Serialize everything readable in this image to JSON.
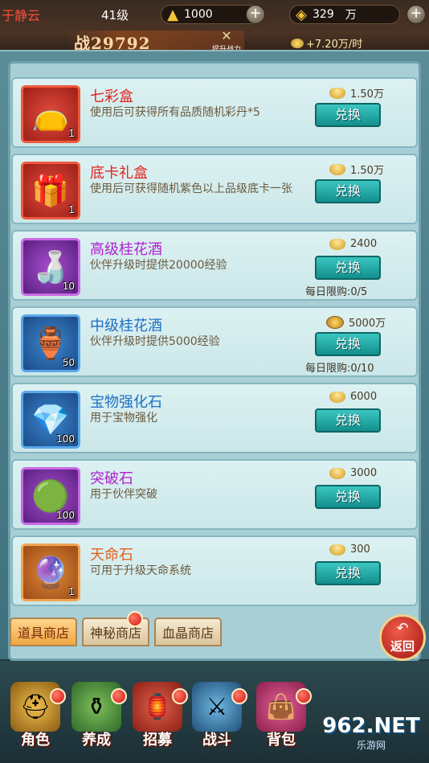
{
  "hud": {
    "player_name": "于静云",
    "level": "41级",
    "gold_ingot": "1000",
    "copper": "329",
    "copper_unit": "万",
    "power_label": "战",
    "power": "29792",
    "boost_label": "提升战力",
    "income": "+7.20万/时"
  },
  "items": [
    {
      "name": "七彩盒",
      "desc": "使用后可获得所有品质随机彩丹*5",
      "price": "1.50万",
      "price_type": "ingot",
      "count": "1",
      "button": "兑换",
      "limit": "",
      "icon": "pouch-icon"
    },
    {
      "name": "底卡礼盒",
      "desc": "使用后可获得随机紫色以上品级底卡一张",
      "price": "1.50万",
      "price_type": "ingot",
      "count": "1",
      "button": "兑换",
      "limit": "",
      "icon": "gift-pouch-icon"
    },
    {
      "name": "高级桂花酒",
      "desc": "伙伴升级时提供20000经验",
      "price": "2400",
      "price_type": "ingot",
      "count": "10",
      "button": "兑换",
      "limit": "每日限购:0/5",
      "icon": "wine-gourd-icon"
    },
    {
      "name": "中级桂花酒",
      "desc": "伙伴升级时提供5000经验",
      "price": "5000万",
      "price_type": "copper",
      "count": "50",
      "button": "兑换",
      "limit": "每日限购:0/10",
      "icon": "wine-jar-icon"
    },
    {
      "name": "宝物强化石",
      "desc": "用于宝物强化",
      "price": "6000",
      "price_type": "ingot",
      "count": "100",
      "button": "兑换",
      "limit": "",
      "icon": "gem-icon"
    },
    {
      "name": "突破石",
      "desc": "用于伙伴突破",
      "price": "3000",
      "price_type": "ingot",
      "count": "100",
      "button": "兑换",
      "limit": "",
      "icon": "breakthrough-orb-icon"
    },
    {
      "name": "天命石",
      "desc": "可用于升级天命系统",
      "price": "300",
      "price_type": "ingot",
      "count": "1",
      "button": "兑换",
      "limit": "",
      "icon": "crystal-icon"
    }
  ],
  "tabs": [
    {
      "label": "道具商店",
      "active": true
    },
    {
      "label": "神秘商店",
      "active": false
    },
    {
      "label": "血晶商店",
      "active": false
    }
  ],
  "back_label": "返回",
  "nav": [
    {
      "label": "角色"
    },
    {
      "label": "养成"
    },
    {
      "label": "招募"
    },
    {
      "label": "战斗"
    },
    {
      "label": "背包"
    }
  ],
  "watermark": {
    "big": "962.NET",
    "small": "乐游网"
  }
}
